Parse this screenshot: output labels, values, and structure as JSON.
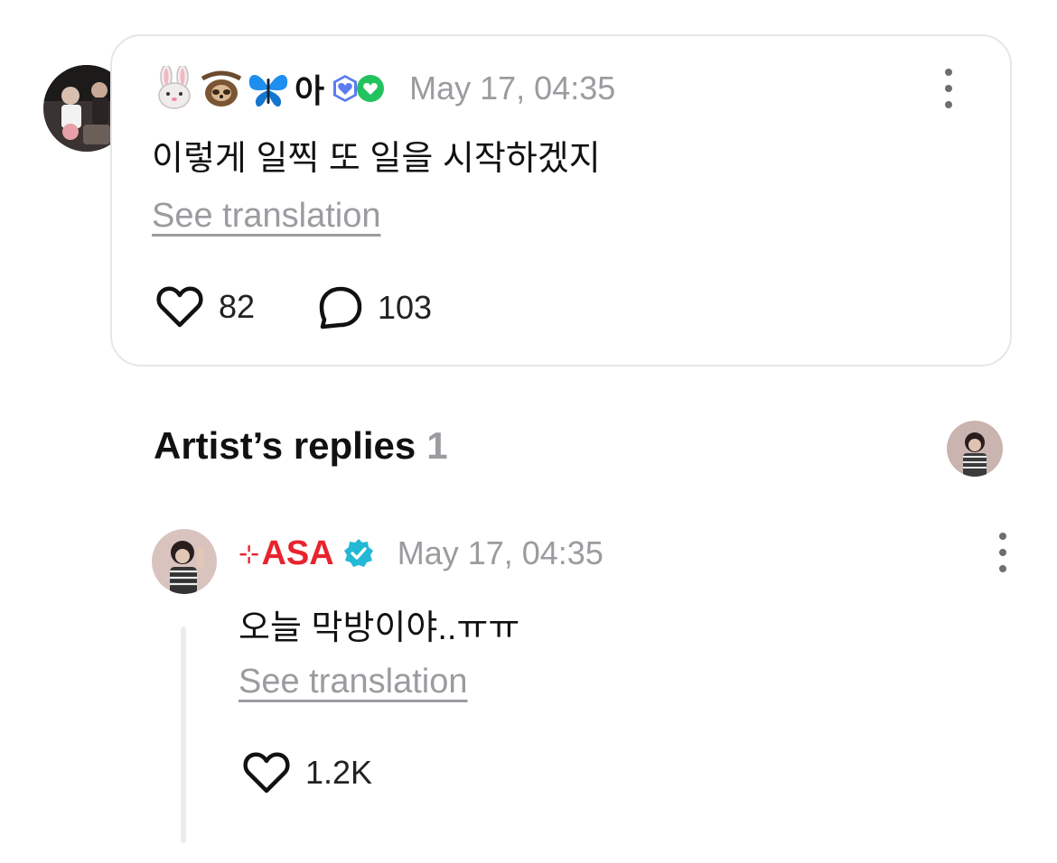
{
  "comment": {
    "nickname_emojis": [
      "rabbit-face-emoji",
      "sloth-emoji",
      "butterfly-emoji"
    ],
    "nickname_text": "아",
    "badges": [
      "membership-heart-badge-blue",
      "membership-heart-badge-green"
    ],
    "timestamp": "May 17, 04:35",
    "body": "이렇게 일찍 또 일을 시작하겠지",
    "see_translation": "See translation",
    "likes": "82",
    "replies": "103"
  },
  "artist_replies": {
    "title": "Artist’s replies",
    "count": "1",
    "reply": {
      "name_prefix": "⊹",
      "name": "ASA",
      "verified_icon": "verified-badge-icon",
      "timestamp": "May 17, 04:35",
      "body": "오늘 막방이야..ㅠㅠ",
      "see_translation": "See translation",
      "likes": "1.2K"
    }
  },
  "colors": {
    "accent_red": "#e8232d",
    "muted_gray": "#9b9ba0",
    "verified_teal": "#22b8d6",
    "card_border": "#e6e6ea"
  }
}
